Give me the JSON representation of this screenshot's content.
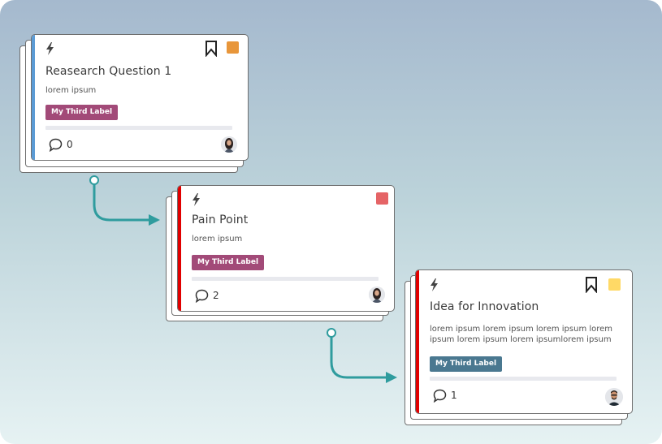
{
  "connector_color": "#2f9c9e",
  "cards": [
    {
      "title": "Reasearch Question 1",
      "description": "lorem ipsum",
      "label": "My Third Label",
      "label_color": "#a24a78",
      "accent_color": "#5b9bd5",
      "swatch_color": "#e8963a",
      "bookmarked": true,
      "comment_count": "0",
      "avatar": "woman-avatar",
      "icon": "bolt-icon"
    },
    {
      "title": "Pain Point",
      "description": "lorem ipsum",
      "label": "My Third Label",
      "label_color": "#a24a78",
      "accent_color": "#e10000",
      "swatch_color": "#e56466",
      "bookmarked": false,
      "comment_count": "2",
      "avatar": "woman-avatar",
      "icon": "bolt-icon"
    },
    {
      "title": "Idea for Innovation",
      "description": "lorem ipsum lorem ipsum lorem ipsum lorem ipsum lorem ipsum lorem ipsumlorem ipsum",
      "description_lines": [
        "lorem ipsum lorem ipsum lorem ipsum lorem",
        "ipsum lorem ipsum lorem ipsumlorem ipsum"
      ],
      "label": "My Third Label",
      "label_color": "#4a7890",
      "accent_color": "#e10000",
      "swatch_color": "#ffd966",
      "bookmarked": true,
      "comment_count": "1",
      "avatar": "man-avatar",
      "icon": "bolt-icon"
    }
  ]
}
